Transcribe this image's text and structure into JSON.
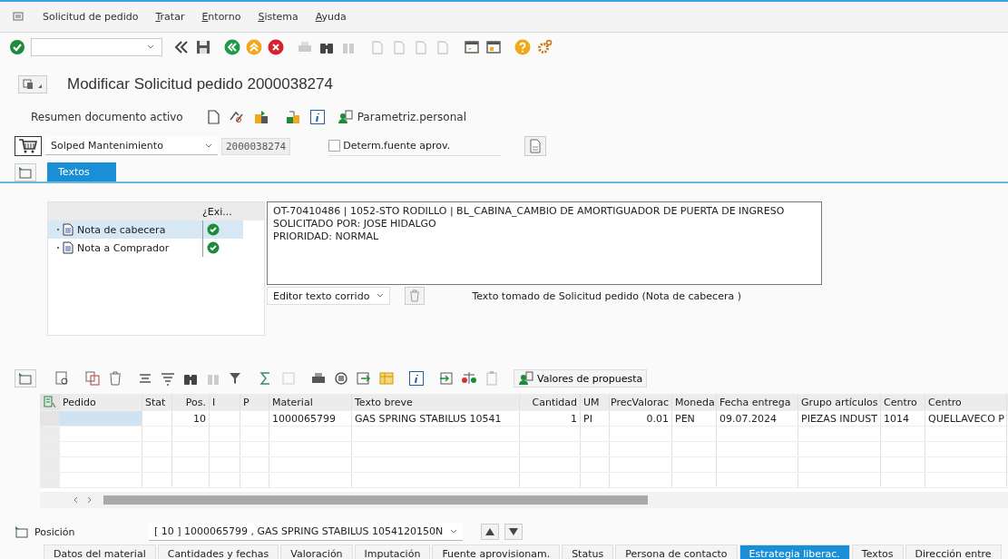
{
  "menu_bar": {
    "items": [
      {
        "label": "Solicitud de pedido",
        "access_key": false
      },
      {
        "label": "Tratar",
        "access_key": true
      },
      {
        "label": "Entorno",
        "access_key": true
      },
      {
        "label": "Sistema",
        "access_key": true
      },
      {
        "label": "Ayuda",
        "access_key": true
      }
    ]
  },
  "title": "Modificar Solicitud pedido 2000038274",
  "app_toolbar": {
    "summary_button": "Resumen documento activo",
    "settings_button": "Parametriz.personal"
  },
  "header": {
    "doc_type": "Solped Mantenimiento",
    "doc_number": "2000038274",
    "source_checkbox": {
      "label": "Determ.fuente aprov.",
      "checked": false
    }
  },
  "header_tabs": [
    {
      "label": "Textos",
      "selected": true
    }
  ],
  "texts": {
    "exists_column": "¿Exi...",
    "items": [
      {
        "label": "Nota de cabecera",
        "exists": true,
        "selected": true
      },
      {
        "label": "Nota a Comprador",
        "exists": true,
        "selected": false
      }
    ],
    "editor_lines": [
      "OT-70410486 | 1052-STO RODILLO | BL_CABINA_CAMBIO DE AMORTIGUADOR DE PUERTA DE INGRESO",
      "SOLICITADO POR: JOSE HIDALGO",
      "PRIORIDAD: NORMAL"
    ],
    "editor_mode": "Editor texto corrido",
    "source_note": "Texto tomado de Solicitud pedido (Nota de cabecera )"
  },
  "items_grid": {
    "proposal_button": "Valores de propuesta",
    "columns": [
      {
        "label": "Pedido",
        "kind": "text"
      },
      {
        "label": "Stat",
        "kind": "text"
      },
      {
        "label": "Pos.",
        "kind": "number"
      },
      {
        "label": "I",
        "kind": "text"
      },
      {
        "label": "P",
        "kind": "text"
      },
      {
        "label": "Material",
        "kind": "text"
      },
      {
        "label": "Texto breve",
        "kind": "text"
      },
      {
        "label": "Cantidad",
        "kind": "number"
      },
      {
        "label": "UM",
        "kind": "text"
      },
      {
        "label": "PrecValorac",
        "kind": "number"
      },
      {
        "label": "Moneda",
        "kind": "text"
      },
      {
        "label": "Fecha entrega",
        "kind": "text"
      },
      {
        "label": "Grupo artículos",
        "kind": "text"
      },
      {
        "label": "Centro",
        "kind": "text"
      },
      {
        "label": "Centro",
        "kind": "text"
      }
    ],
    "rows": [
      {
        "selected": true,
        "cells": [
          "",
          "",
          "10",
          "",
          "",
          "1000065799",
          "GAS SPRING STABILUS 10541",
          "1",
          "PI",
          "0.01",
          "PEN",
          "09.07.2024",
          "PIEZAS INDUST",
          "1014",
          "QUELLAVECO P"
        ]
      }
    ]
  },
  "item_selector": {
    "label": "Posición",
    "value": "[ 10 ] 1000065799 , GAS SPRING STABILUS 1054120150N"
  },
  "item_tabs": [
    {
      "label": "Datos del material",
      "selected": false
    },
    {
      "label": "Cantidades y fechas",
      "selected": false
    },
    {
      "label": "Valoración",
      "selected": false
    },
    {
      "label": "Imputación",
      "selected": false
    },
    {
      "label": "Fuente aprovisionam.",
      "selected": false
    },
    {
      "label": "Status",
      "selected": false
    },
    {
      "label": "Persona de contacto",
      "selected": false
    },
    {
      "label": "Estrategia liberac.",
      "selected": true
    },
    {
      "label": "Textos",
      "selected": false
    },
    {
      "label": "Dirección entre",
      "selected": false
    }
  ]
}
